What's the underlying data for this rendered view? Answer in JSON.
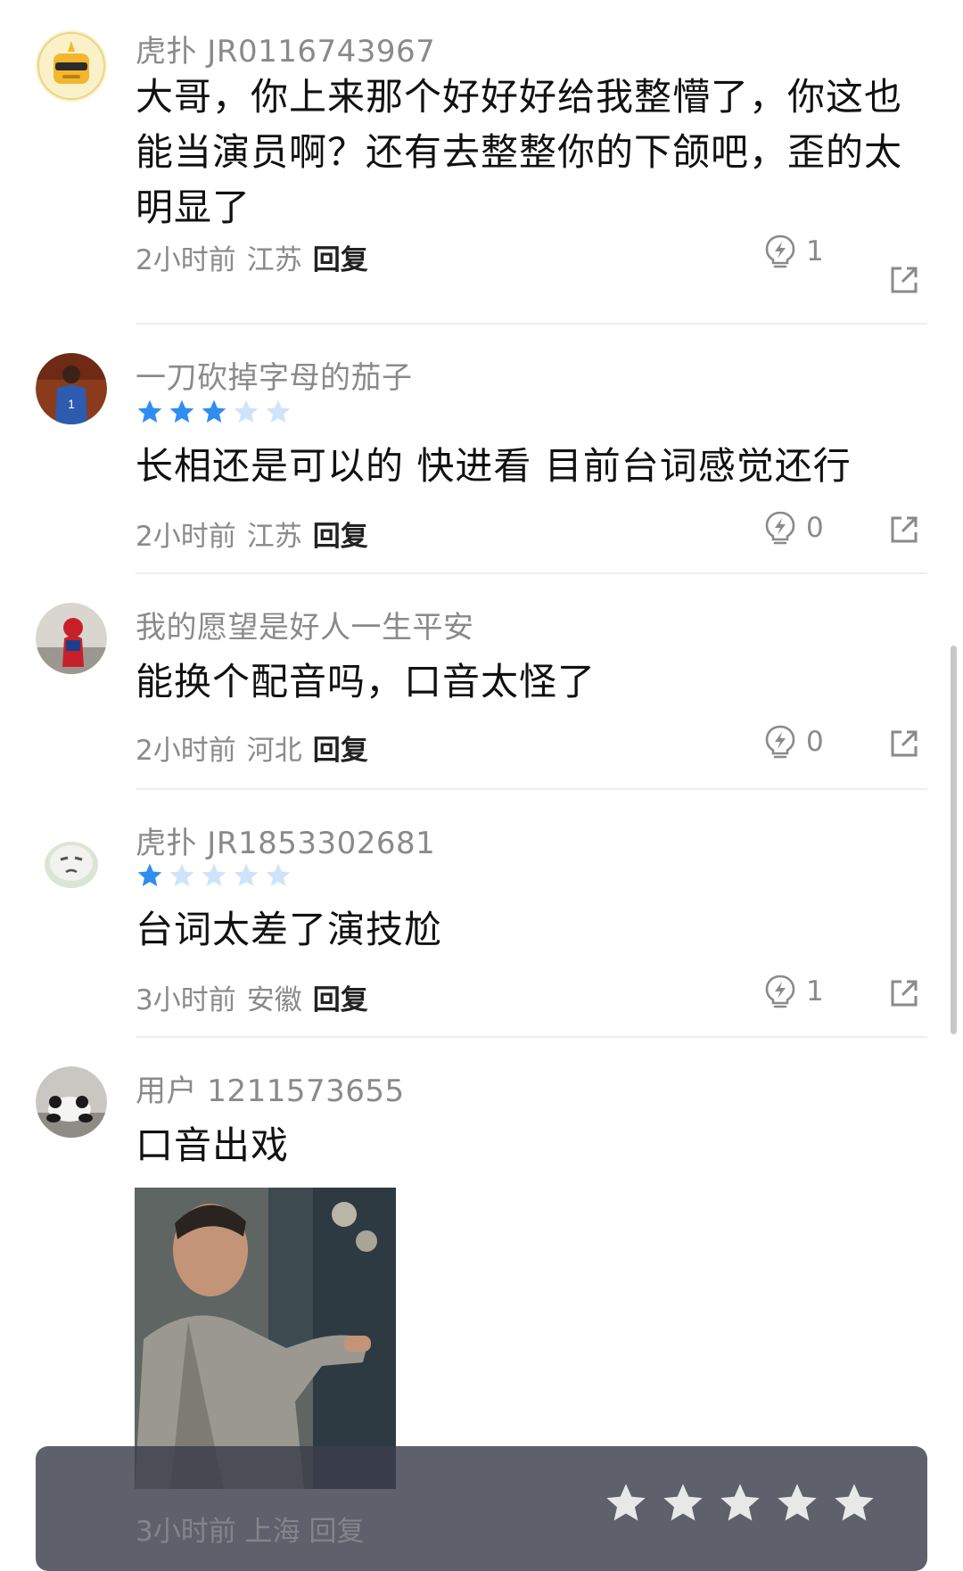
{
  "comments": [
    {
      "username": "虎扑 JR0116743967",
      "avatar": "sunglasses-robot-avatar",
      "rating": null,
      "text": "大哥，你上来那个好好好给我整懵了，你这也能当演员啊？还有去整整你的下颌吧，歪的太明显了",
      "time": "2小时前",
      "location": "江苏",
      "reply_label": "回复",
      "likes": "1"
    },
    {
      "username": "一刀砍掉字母的茄子",
      "avatar": "basketball-player-avatar",
      "rating": 3,
      "text": "长相还是可以的 快进看 目前台词感觉还行",
      "time": "2小时前",
      "location": "江苏",
      "reply_label": "回复",
      "likes": "0"
    },
    {
      "username": "我的愿望是好人一生平安",
      "avatar": "spiderman-avatar",
      "rating": null,
      "text": "能换个配音吗，口音太怪了",
      "time": "2小时前",
      "location": "河北",
      "reply_label": "回复",
      "likes": "0"
    },
    {
      "username": "虎扑 JR1853302681",
      "avatar": "cartoon-face-avatar",
      "rating": 1,
      "text": "台词太差了演技尬",
      "time": "3小时前",
      "location": "安徽",
      "reply_label": "回复",
      "likes": "1"
    },
    {
      "username": "用户 1211573655",
      "avatar": "panda-avatar",
      "rating": null,
      "text": "口音出戏",
      "time": "3小时前",
      "location": "上海",
      "reply_label": "回复",
      "likes": ""
    }
  ],
  "rating_bar": {
    "stars": 5,
    "selected": 0
  },
  "colors": {
    "star_filled": "#2f8df0",
    "star_empty": "#cfe4fb",
    "meta_gray": "#8a8a8a"
  },
  "icons": {
    "like": "lightbulb-lightning-icon",
    "share": "share-out-icon",
    "star": "star-icon"
  }
}
